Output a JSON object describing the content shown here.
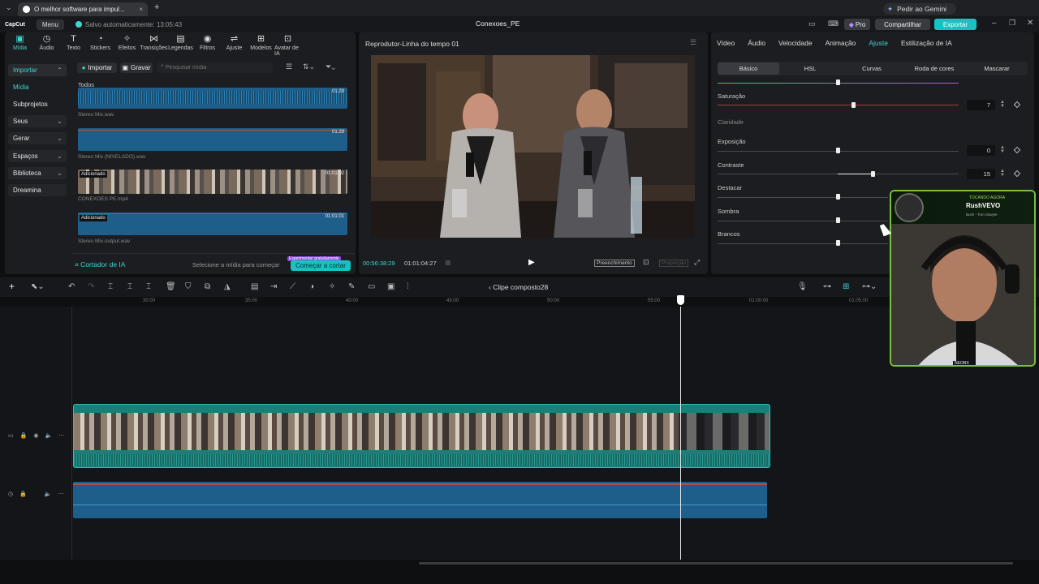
{
  "browser": {
    "tab_title": "O melhor software para impul...",
    "close": "×",
    "new_tab": "+"
  },
  "app": {
    "logo": "CapCut",
    "menu": "Menu",
    "autosave": "Salvo automaticamente: 13:05:43",
    "project_title": "Conexoes_PE",
    "pro_label": "Pro",
    "share_label": "Compartilhar",
    "export_label": "Exportar",
    "gemini_label": "Pedir ao Gemini"
  },
  "media_toolbar": [
    "Mídia",
    "Áudio",
    "Texto",
    "Stickers",
    "Efeitos",
    "Transições",
    "Legendas",
    "Filtros",
    "Ajuste",
    "Modelos",
    "Avatar de IA"
  ],
  "media_toolbar_glyphs": [
    "▣",
    "◷",
    "T",
    "◔",
    "✧",
    "⋈",
    "▤",
    "◉",
    "⇌",
    "⊞",
    "⊡"
  ],
  "sidebar": {
    "import": "Importar",
    "items": [
      "Mídia",
      "Subprojetos",
      "Seus",
      "Gerar",
      "Espaços",
      "Biblioteca",
      "Dreamina"
    ]
  },
  "media": {
    "import_btn": "Importar",
    "record_btn": "Gravar",
    "search_placeholder": "Pesquisar mídia",
    "section": "Todos",
    "clips": [
      {
        "name": "Stereo Mix.wav",
        "duration": "01:29",
        "badge": ""
      },
      {
        "name": "Stereo Mix (NIVELADO).wav",
        "duration": "01:29",
        "badge": ""
      },
      {
        "name": "CONEXOES PE.mp4",
        "duration": "01:01:02",
        "badge": "Adicionado"
      },
      {
        "name": "Stereo Mix.output.wav",
        "duration": "01:01:01",
        "badge": "Adicionado"
      }
    ],
    "ai_cutter": "Cortador de IA",
    "ai_hint": "Selecione a mídia para começar",
    "trial_badge": "Experimentar gratuitamente",
    "start_cut": "Começar a cortar"
  },
  "player": {
    "title": "Reprodutor-Linha do tempo 01",
    "current_time": "00:56:38:29",
    "total_time": "01:01:04:27",
    "fill_label": "Preenchimento",
    "ratio_label": "Proporção"
  },
  "properties": {
    "tabs": [
      "Vídeo",
      "Áudio",
      "Velocidade",
      "Animação",
      "Ajuste",
      "Estilização de IA"
    ],
    "active_tab": "Ajuste",
    "subtabs": [
      "Básico",
      "HSL",
      "Curvas",
      "Roda de cores",
      "Mascarar"
    ],
    "params": [
      {
        "label": "Saturação",
        "value": "7"
      },
      {
        "label": "Claridade",
        "value": ""
      },
      {
        "label": "Exposição",
        "value": "0"
      },
      {
        "label": "Contraste",
        "value": "15"
      },
      {
        "label": "Destacar",
        "value": ""
      },
      {
        "label": "Sombra",
        "value": ""
      },
      {
        "label": "Brancos",
        "value": ""
      }
    ]
  },
  "webcam": {
    "tag": "TOCANDO AGORA",
    "artist": "RushVEVO",
    "track": "Bush - Tom Sawyer",
    "watermark": "NEORX"
  },
  "timeline": {
    "compound_clip": "Clipe composto28",
    "ticks": [
      "30:00",
      "35:00",
      "40:00",
      "45:00",
      "50:00",
      "55:00",
      "01:00:00",
      "01:05:00"
    ]
  },
  "colors": {
    "accent": "#3dd6d0",
    "clip_teal": "#1a7f78",
    "audio_blue": "#1d5f8a",
    "export_btn": "#19c2c2"
  }
}
